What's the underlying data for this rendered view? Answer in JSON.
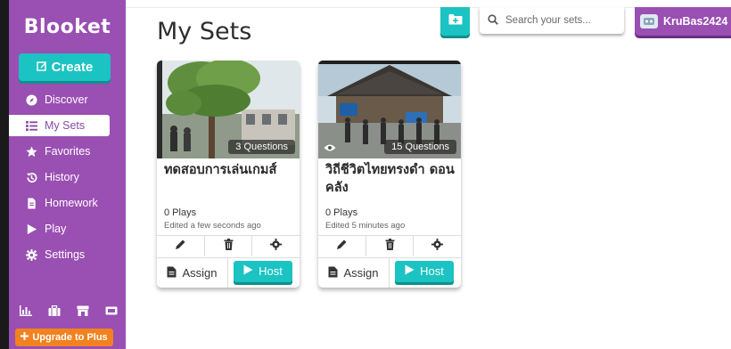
{
  "sidebar": {
    "logo": "Blooket",
    "create_label": "Create",
    "items": [
      {
        "label": "Discover",
        "icon": "compass-icon"
      },
      {
        "label": "My Sets",
        "icon": "list-icon"
      },
      {
        "label": "Favorites",
        "icon": "star-icon"
      },
      {
        "label": "History",
        "icon": "history-icon"
      },
      {
        "label": "Homework",
        "icon": "document-icon"
      },
      {
        "label": "Play",
        "icon": "play-icon"
      },
      {
        "label": "Settings",
        "icon": "gear-icon"
      }
    ],
    "active_item": "My Sets",
    "bottom_icons": [
      "chart-icon",
      "briefcase-icon",
      "store-icon",
      "ticket-icon"
    ],
    "upgrade_label": "Upgrade to Plus"
  },
  "header": {
    "page_title": "My Sets",
    "search_placeholder": "Search your sets...",
    "username": "KruBas2424"
  },
  "sets": [
    {
      "title": "ทดสอบการเล่นเกมส์",
      "questions": "3 Questions",
      "plays": "0 Plays",
      "edited": "Edited a few seconds ago",
      "assign_label": "Assign",
      "host_label": "Host"
    },
    {
      "title": "วิถีชีวิตไทยทรงดำ ดอนคลัง",
      "questions": "15 Questions",
      "plays": "0 Plays",
      "edited": "Edited 5 minutes ago",
      "assign_label": "Assign",
      "host_label": "Host"
    }
  ],
  "colors": {
    "sidebar": "#9a4fb3",
    "accent": "#1bc3c2",
    "upgrade": "#f2821f"
  }
}
